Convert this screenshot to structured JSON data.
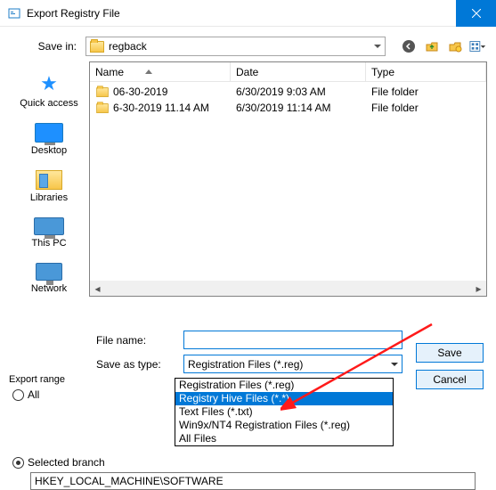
{
  "title": "Export Registry File",
  "savein": {
    "label": "Save in:",
    "value": "regback"
  },
  "columns": {
    "name": "Name",
    "date": "Date",
    "type": "Type"
  },
  "files": [
    {
      "name": "06-30-2019",
      "date": "6/30/2019 9:03 AM",
      "type": "File folder"
    },
    {
      "name": "6-30-2019 11.14 AM",
      "date": "6/30/2019 11:14 AM",
      "type": "File folder"
    }
  ],
  "places": {
    "quick": "Quick access",
    "desktop": "Desktop",
    "libraries": "Libraries",
    "thispc": "This PC",
    "network": "Network"
  },
  "filename_label": "File name:",
  "filename_value": "",
  "saveas_label": "Save as type:",
  "saveas_value": "Registration Files (*.reg)",
  "filetype_options": [
    "Registration Files (*.reg)",
    "Registry Hive Files (*.*)",
    "Text Files (*.txt)",
    "Win9x/NT4 Registration Files (*.reg)",
    "All Files"
  ],
  "filetype_selected_index": 1,
  "buttons": {
    "save": "Save",
    "cancel": "Cancel"
  },
  "export": {
    "title": "Export range",
    "all": "All",
    "selected": "Selected branch",
    "branch_path": "HKEY_LOCAL_MACHINE\\SOFTWARE"
  }
}
